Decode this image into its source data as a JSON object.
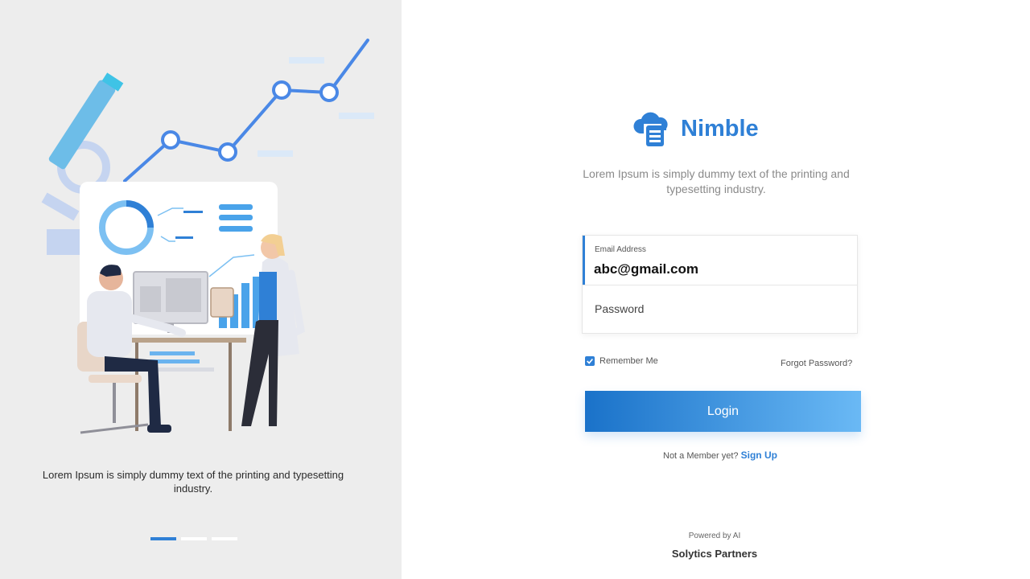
{
  "left_panel": {
    "caption": "Lorem Ipsum is simply dummy text of the printing and typesetting industry.",
    "slides_total": 3,
    "active_slide": 1
  },
  "brand": {
    "name": "Nimble",
    "logo_icon": "cloud-database-icon",
    "color": "#2f80d6"
  },
  "tagline": "Lorem Ipsum is simply dummy text of the printing and typesetting industry.",
  "form": {
    "email_label": "Email Address",
    "email_value": "abc@gmail.com",
    "password_placeholder": "Password",
    "remember_label": "Remember Me",
    "remember_checked": true,
    "forgot_label": "Forgot Password?",
    "login_label": "Login"
  },
  "signup": {
    "prompt": "Not a Member yet?",
    "link_label": "Sign Up"
  },
  "footer": {
    "powered_by": "Powered by AI",
    "company": "Solytics Partners"
  },
  "colors": {
    "accent": "#2f80d6",
    "left_background": "#ededed",
    "button_gradient_start": "#1a72c9",
    "button_gradient_end": "#6ab9f5"
  }
}
